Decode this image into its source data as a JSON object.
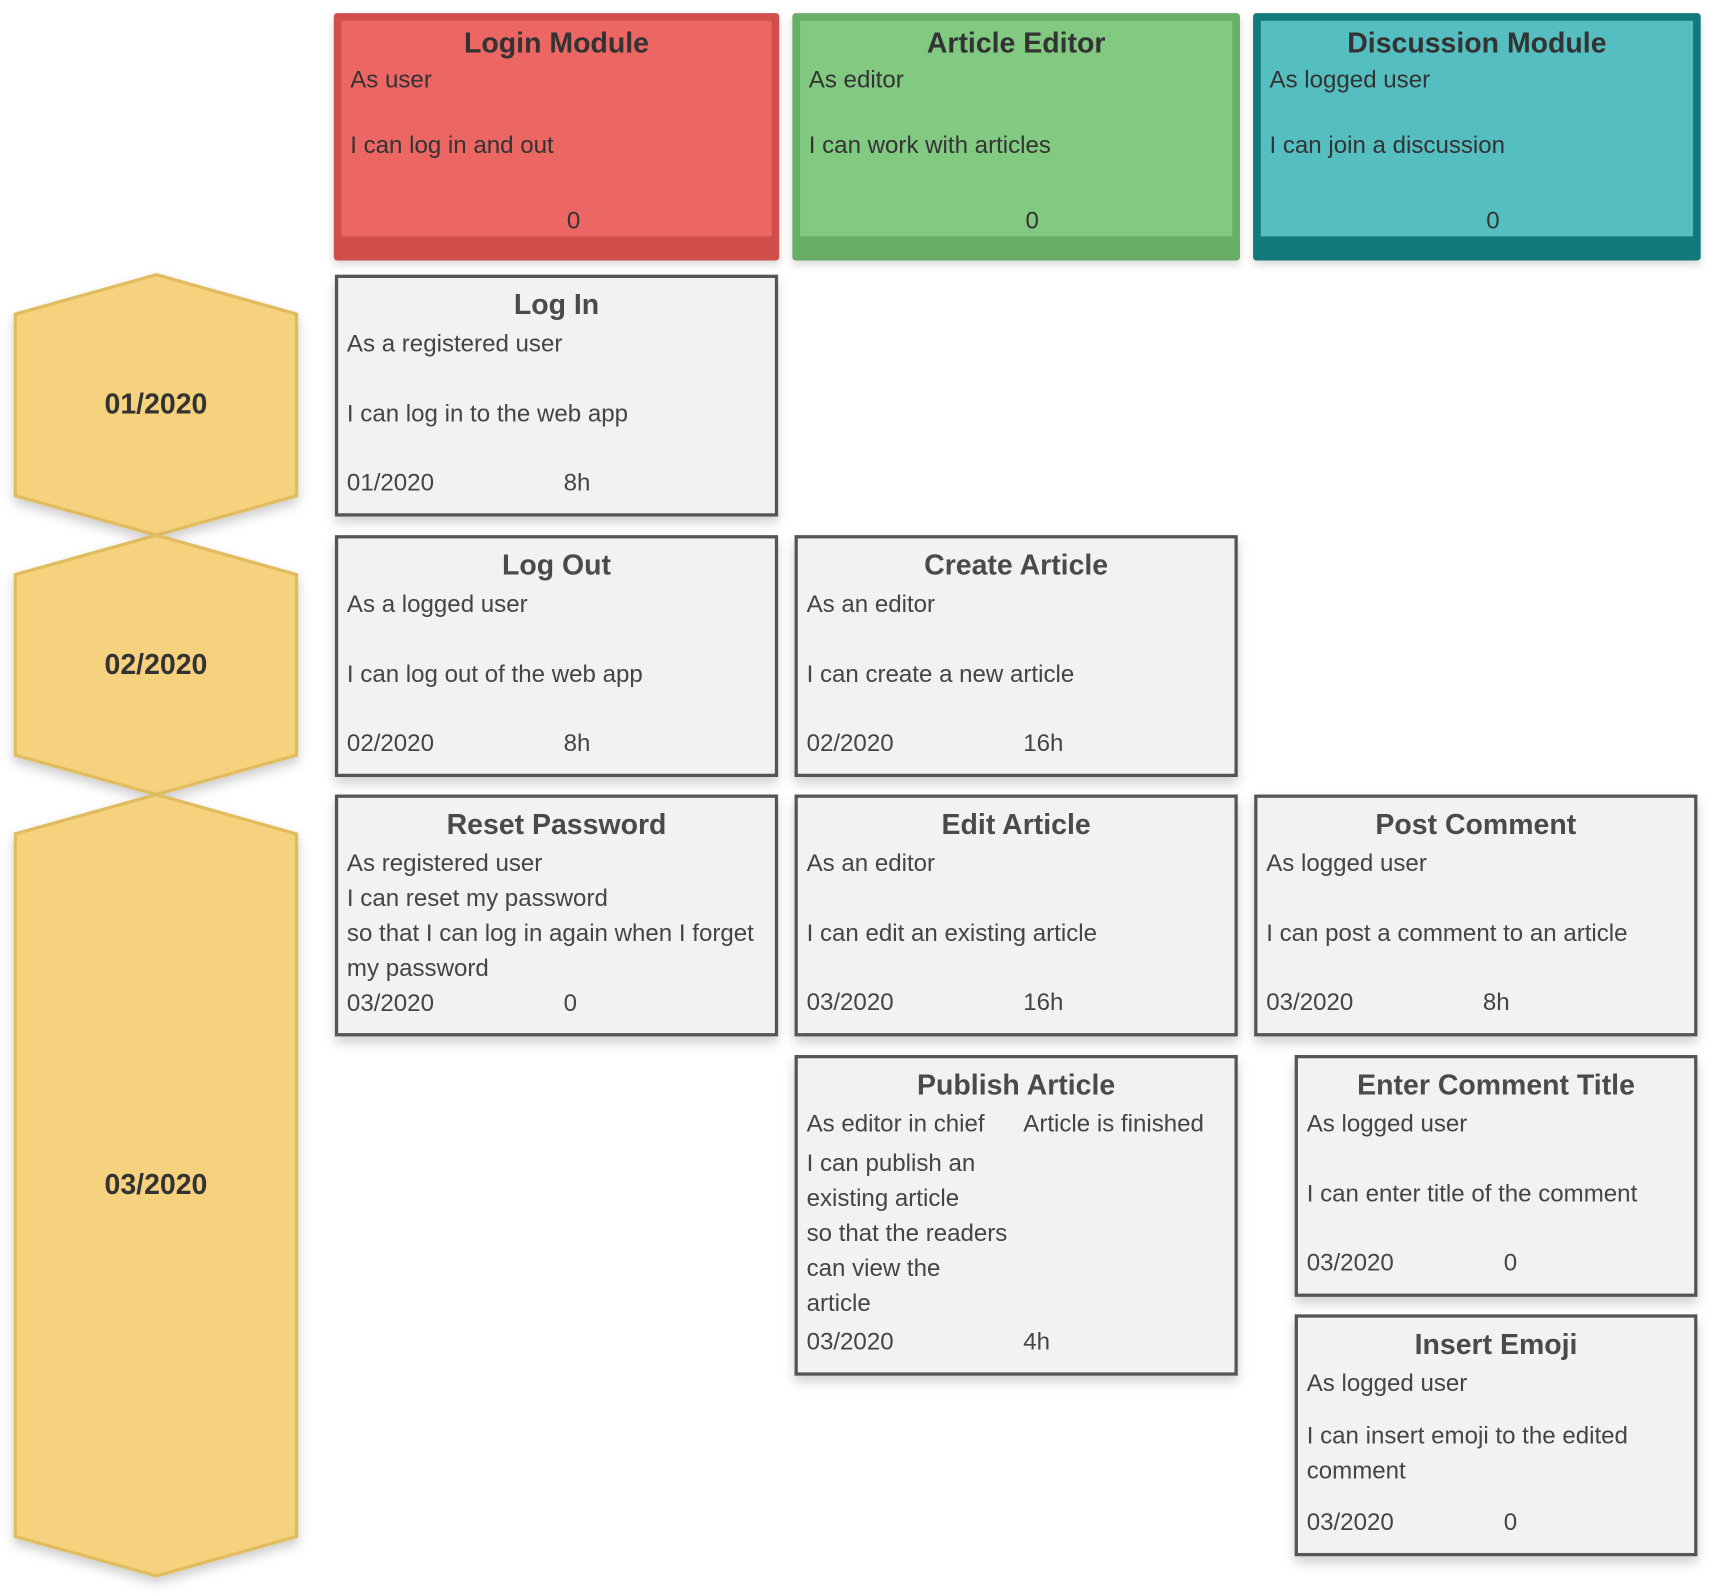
{
  "epics": [
    {
      "title": "Login Module",
      "as": "As user",
      "i_can": "I can log in and out",
      "estimate": "0",
      "fill": "#ec6664",
      "border": "#d04e4c"
    },
    {
      "title": "Article Editor",
      "as": "As editor",
      "i_can": "I can work with articles",
      "estimate": "0",
      "fill": "#82c982",
      "border": "#68ae68"
    },
    {
      "title": "Discussion Module",
      "as": "As logged user",
      "i_can": "I can join a discussion",
      "estimate": "0",
      "fill": "#55bec1",
      "border": "#127a7a"
    }
  ],
  "releases": [
    {
      "label": "01/2020"
    },
    {
      "label": "02/2020"
    },
    {
      "label": "03/2020"
    }
  ],
  "release_colors": {
    "fill": "#f6d27e",
    "border": "#e0bc5e"
  },
  "stories": [
    {
      "epic": "Login Module",
      "title": "Log In",
      "as": "As a registered user",
      "i_can": "I can log in to the web app",
      "so_that": "",
      "acceptance": "",
      "release": "01/2020",
      "estimate": "8h"
    },
    {
      "epic": "Login Module",
      "title": "Log Out",
      "as": "As a logged user",
      "i_can": "I can log out of the web app",
      "so_that": "",
      "acceptance": "",
      "release": "02/2020",
      "estimate": "8h"
    },
    {
      "epic": "Article Editor",
      "title": "Create Article",
      "as": "As an editor",
      "i_can": "I can create a new article",
      "so_that": "",
      "acceptance": "",
      "release": "02/2020",
      "estimate": "16h"
    },
    {
      "epic": "Login Module",
      "title": "Reset Password",
      "as": "As registered user",
      "i_can": "I can reset my password",
      "so_that": "so that I can log in again when I forget my password",
      "acceptance": "",
      "release": "03/2020",
      "estimate": "0"
    },
    {
      "epic": "Article Editor",
      "title": "Edit Article",
      "as": "As an editor",
      "i_can": "I can edit an existing article",
      "so_that": "",
      "acceptance": "",
      "release": "03/2020",
      "estimate": "16h"
    },
    {
      "epic": "Discussion Module",
      "title": "Post Comment",
      "as": "As logged user",
      "i_can": "I can post a comment to an article",
      "so_that": "",
      "acceptance": "",
      "release": "03/2020",
      "estimate": "8h"
    },
    {
      "epic": "Article Editor",
      "title": "Publish Article",
      "as": "As editor in chief",
      "i_can": "I can publish an existing article",
      "so_that": "so that the readers can view the article",
      "acceptance": "Article is finished",
      "release": "03/2020",
      "estimate": "4h"
    },
    {
      "epic": "Discussion Module",
      "title": "Enter Comment Title",
      "as": "As logged user",
      "i_can": "I can enter title of the comment",
      "so_that": "",
      "acceptance": "",
      "release": "03/2020",
      "estimate": "0"
    },
    {
      "epic": "Discussion Module",
      "title": "Insert Emoji",
      "as": "As logged user",
      "i_can": "I can insert emoji to the edited comment",
      "so_that": "",
      "acceptance": "",
      "release": "03/2020",
      "estimate": "0"
    }
  ]
}
